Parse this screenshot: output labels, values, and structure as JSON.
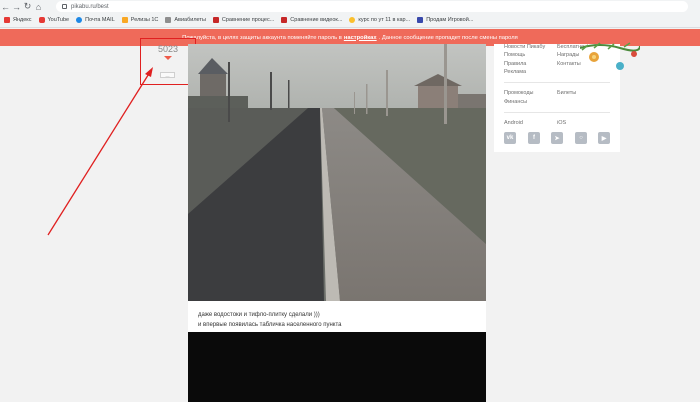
{
  "browser": {
    "url": "pikabu.ru/best",
    "bookmarks": [
      {
        "label": "Яндекс",
        "color": "#e53935"
      },
      {
        "label": "YouTube",
        "color": "#e53935"
      },
      {
        "label": "Почта MAIL",
        "color": "#1e88e5"
      },
      {
        "label": "Релизы 1С",
        "color": "#f9a825"
      },
      {
        "label": "Авиабилеты",
        "color": "#8e8e8e"
      },
      {
        "label": "Сравнение процес...",
        "color": "#c62828"
      },
      {
        "label": "Сравнение видеок...",
        "color": "#c62828"
      },
      {
        "label": "курс по ут 11 в кар...",
        "color": "#fbc02d"
      },
      {
        "label": "Продам Игровой...",
        "color": "#3949ab"
      }
    ]
  },
  "notice": {
    "text_before": "Пожалуйста, в целях защиты аккаунта поменяйте пароль в",
    "link": "настройках",
    "text_after": ". Данное сообщение пропадет после смены пароля"
  },
  "story": {
    "rating": "5023",
    "mini_button": "—",
    "caption_line1": "даже водостоки и тифло-плитку сделали )))",
    "caption_line2": "и впервые появилась табличка населенного пункта"
  },
  "sidebar": {
    "links_left_1": [
      "Новости Пикабу",
      "Помощь",
      "Правила",
      "Реклама"
    ],
    "links_right_1": [
      "Бесплатно",
      "Награды",
      "Контакты"
    ],
    "links_left_2": [
      "Промокоды",
      "Финансы"
    ],
    "links_right_2": [
      "Билеты"
    ],
    "app_android": "Android",
    "app_ios": "iOS",
    "socials": [
      "vk-icon",
      "facebook-icon",
      "telegram-icon",
      "instagram-icon",
      "youtube-icon"
    ]
  },
  "colors": {
    "accent": "#ef6a5a",
    "highlight": "#e02020"
  }
}
